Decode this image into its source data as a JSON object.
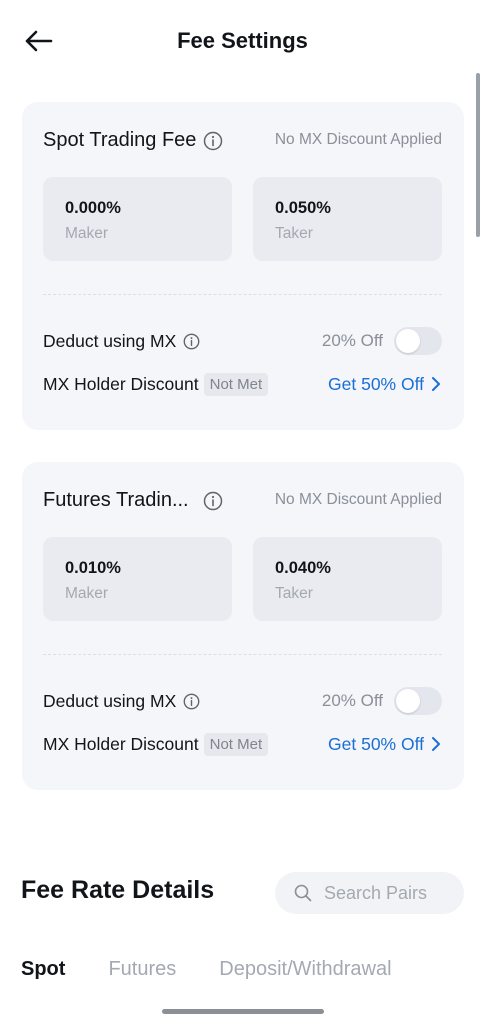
{
  "header": {
    "title": "Fee Settings"
  },
  "spot": {
    "title": "Spot Trading Fee",
    "status": "No MX Discount Applied",
    "maker_value": "0.000%",
    "maker_label": "Maker",
    "taker_value": "0.050%",
    "taker_label": "Taker",
    "deduct_label": "Deduct using MX",
    "deduct_off": "20% Off",
    "deduct_enabled": false,
    "holder_label": "MX Holder Discount",
    "holder_badge": "Not Met",
    "promo_link": "Get 50% Off"
  },
  "futures": {
    "title": "Futures Tradin...",
    "status": "No MX Discount Applied",
    "maker_value": "0.010%",
    "maker_label": "Maker",
    "taker_value": "0.040%",
    "taker_label": "Taker",
    "deduct_label": "Deduct using MX",
    "deduct_off": "20% Off",
    "deduct_enabled": false,
    "holder_label": "MX Holder Discount",
    "holder_badge": "Not Met",
    "promo_link": "Get 50% Off"
  },
  "details": {
    "title": "Fee Rate Details",
    "search_placeholder": "Search Pairs",
    "tabs": [
      {
        "label": "Spot",
        "active": true
      },
      {
        "label": "Futures",
        "active": false
      },
      {
        "label": "Deposit/Withdrawal",
        "active": false
      }
    ]
  },
  "colors": {
    "accent": "#1a6fd6",
    "card_bg": "#f4f6fa",
    "muted": "#8a8f98"
  },
  "icons": [
    "back-arrow-icon",
    "info-icon",
    "chevron-right-icon",
    "search-icon"
  ]
}
